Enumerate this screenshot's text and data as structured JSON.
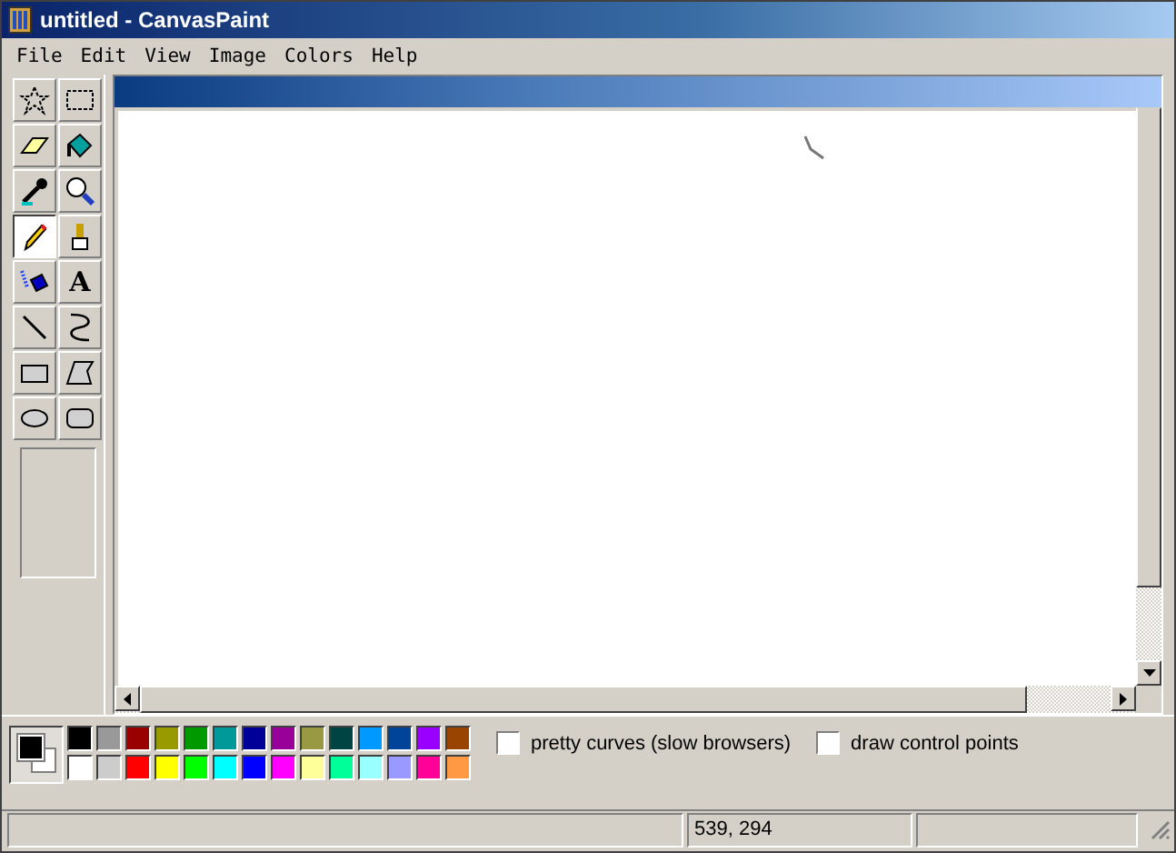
{
  "window": {
    "title": "untitled - CanvasPaint"
  },
  "menu": [
    "File",
    "Edit",
    "View",
    "Image",
    "Colors",
    "Help"
  ],
  "tools": [
    {
      "kind": "free-select",
      "selected": false
    },
    {
      "kind": "rect-select",
      "selected": false
    },
    {
      "kind": "eraser",
      "selected": false
    },
    {
      "kind": "fill",
      "selected": false
    },
    {
      "kind": "picker",
      "selected": false
    },
    {
      "kind": "magnifier",
      "selected": false
    },
    {
      "kind": "pencil",
      "selected": true
    },
    {
      "kind": "brush",
      "selected": false
    },
    {
      "kind": "airbrush",
      "selected": false
    },
    {
      "kind": "text",
      "label": "A",
      "selected": false
    },
    {
      "kind": "line",
      "selected": false
    },
    {
      "kind": "curve",
      "selected": false
    },
    {
      "kind": "rectangle",
      "selected": false
    },
    {
      "kind": "polygon",
      "selected": false
    },
    {
      "kind": "ellipse",
      "selected": false
    },
    {
      "kind": "rounded-rect",
      "selected": false
    }
  ],
  "palette": [
    {
      "color": "#000000"
    },
    {
      "color": "#999999"
    },
    {
      "color": "#990000"
    },
    {
      "color": "#999900"
    },
    {
      "color": "#009900"
    },
    {
      "color": "#009999"
    },
    {
      "color": "#000099"
    },
    {
      "color": "#990099"
    },
    {
      "color": "#999944"
    },
    {
      "color": "#004444"
    },
    {
      "color": "#0099ff"
    },
    {
      "color": "#004499"
    },
    {
      "color": "#9900ff"
    },
    {
      "color": "#994400"
    },
    {
      "color": "#ffffff"
    },
    {
      "color": "#cccccc"
    },
    {
      "color": "#ff0000"
    },
    {
      "color": "#ffff00"
    },
    {
      "color": "#00ff00"
    },
    {
      "color": "#00ffff"
    },
    {
      "color": "#0000ff"
    },
    {
      "color": "#ff00ff"
    },
    {
      "color": "#ffff99"
    },
    {
      "color": "#00ff99"
    },
    {
      "color": "#99ffff"
    },
    {
      "color": "#9999ff"
    },
    {
      "color": "#ff0099"
    },
    {
      "color": "#ff9944"
    }
  ],
  "options": [
    {
      "label": "pretty curves (slow browsers)",
      "checked": false
    },
    {
      "label": "draw control points",
      "checked": false
    }
  ],
  "status_bar": {
    "coordinates": "539, 294"
  }
}
